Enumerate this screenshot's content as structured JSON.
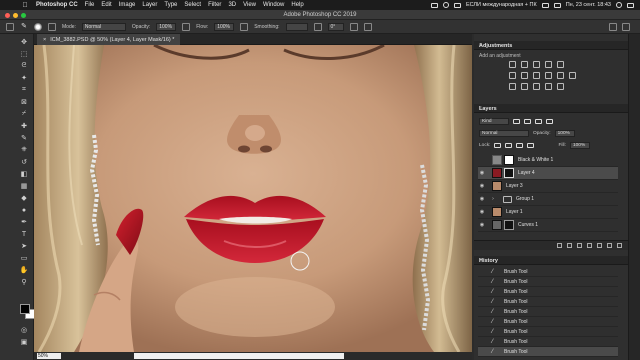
{
  "menubar": {
    "app": "Photoshop CC",
    "items": [
      "File",
      "Edit",
      "Image",
      "Layer",
      "Type",
      "Select",
      "Filter",
      "3D",
      "View",
      "Window",
      "Help"
    ],
    "status_text": "ЕСЛИ международная + ПК",
    "clock": "Пн, 23 сент. 18:43"
  },
  "window": {
    "title": "Adobe Photoshop CC 2019"
  },
  "options": {
    "mode_label": "Mode:",
    "mode_value": "Normal",
    "opacity_label": "Opacity:",
    "opacity_value": "100%",
    "flow_label": "Flow:",
    "flow_value": "100%",
    "smoothing_label": "Smoothing:",
    "smoothing_value": "",
    "angle_value": "0°"
  },
  "document": {
    "tab_title": "ICM_3882.PSD @ 50% (Layer 4, Layer Mask/16) *",
    "zoom": "50%"
  },
  "adjustments": {
    "title": "Adjustments",
    "subtitle": "Add an adjustment"
  },
  "layers": {
    "title": "Layers",
    "kind_label": "Kind",
    "blend_mode": "Normal",
    "opacity_label": "Opacity:",
    "opacity_value": "100%",
    "lock_label": "Lock:",
    "fill_label": "Fill:",
    "fill_value": "100%",
    "items": [
      {
        "name": "Black & White 1"
      },
      {
        "name": "Layer 4"
      },
      {
        "name": "Layer 3"
      },
      {
        "name": "Group 1"
      },
      {
        "name": "Layer 1"
      },
      {
        "name": "Curves 1"
      }
    ]
  },
  "history": {
    "title": "History",
    "items": [
      "Brush Tool",
      "Brush Tool",
      "Brush Tool",
      "Brush Tool",
      "Brush Tool",
      "Brush Tool",
      "Brush Tool",
      "Brush Tool",
      "Brush Tool"
    ]
  },
  "colors": {
    "accent_red": "#c8102e",
    "panel_bg": "#2f2f2f",
    "selection": "#4b4b4b"
  }
}
